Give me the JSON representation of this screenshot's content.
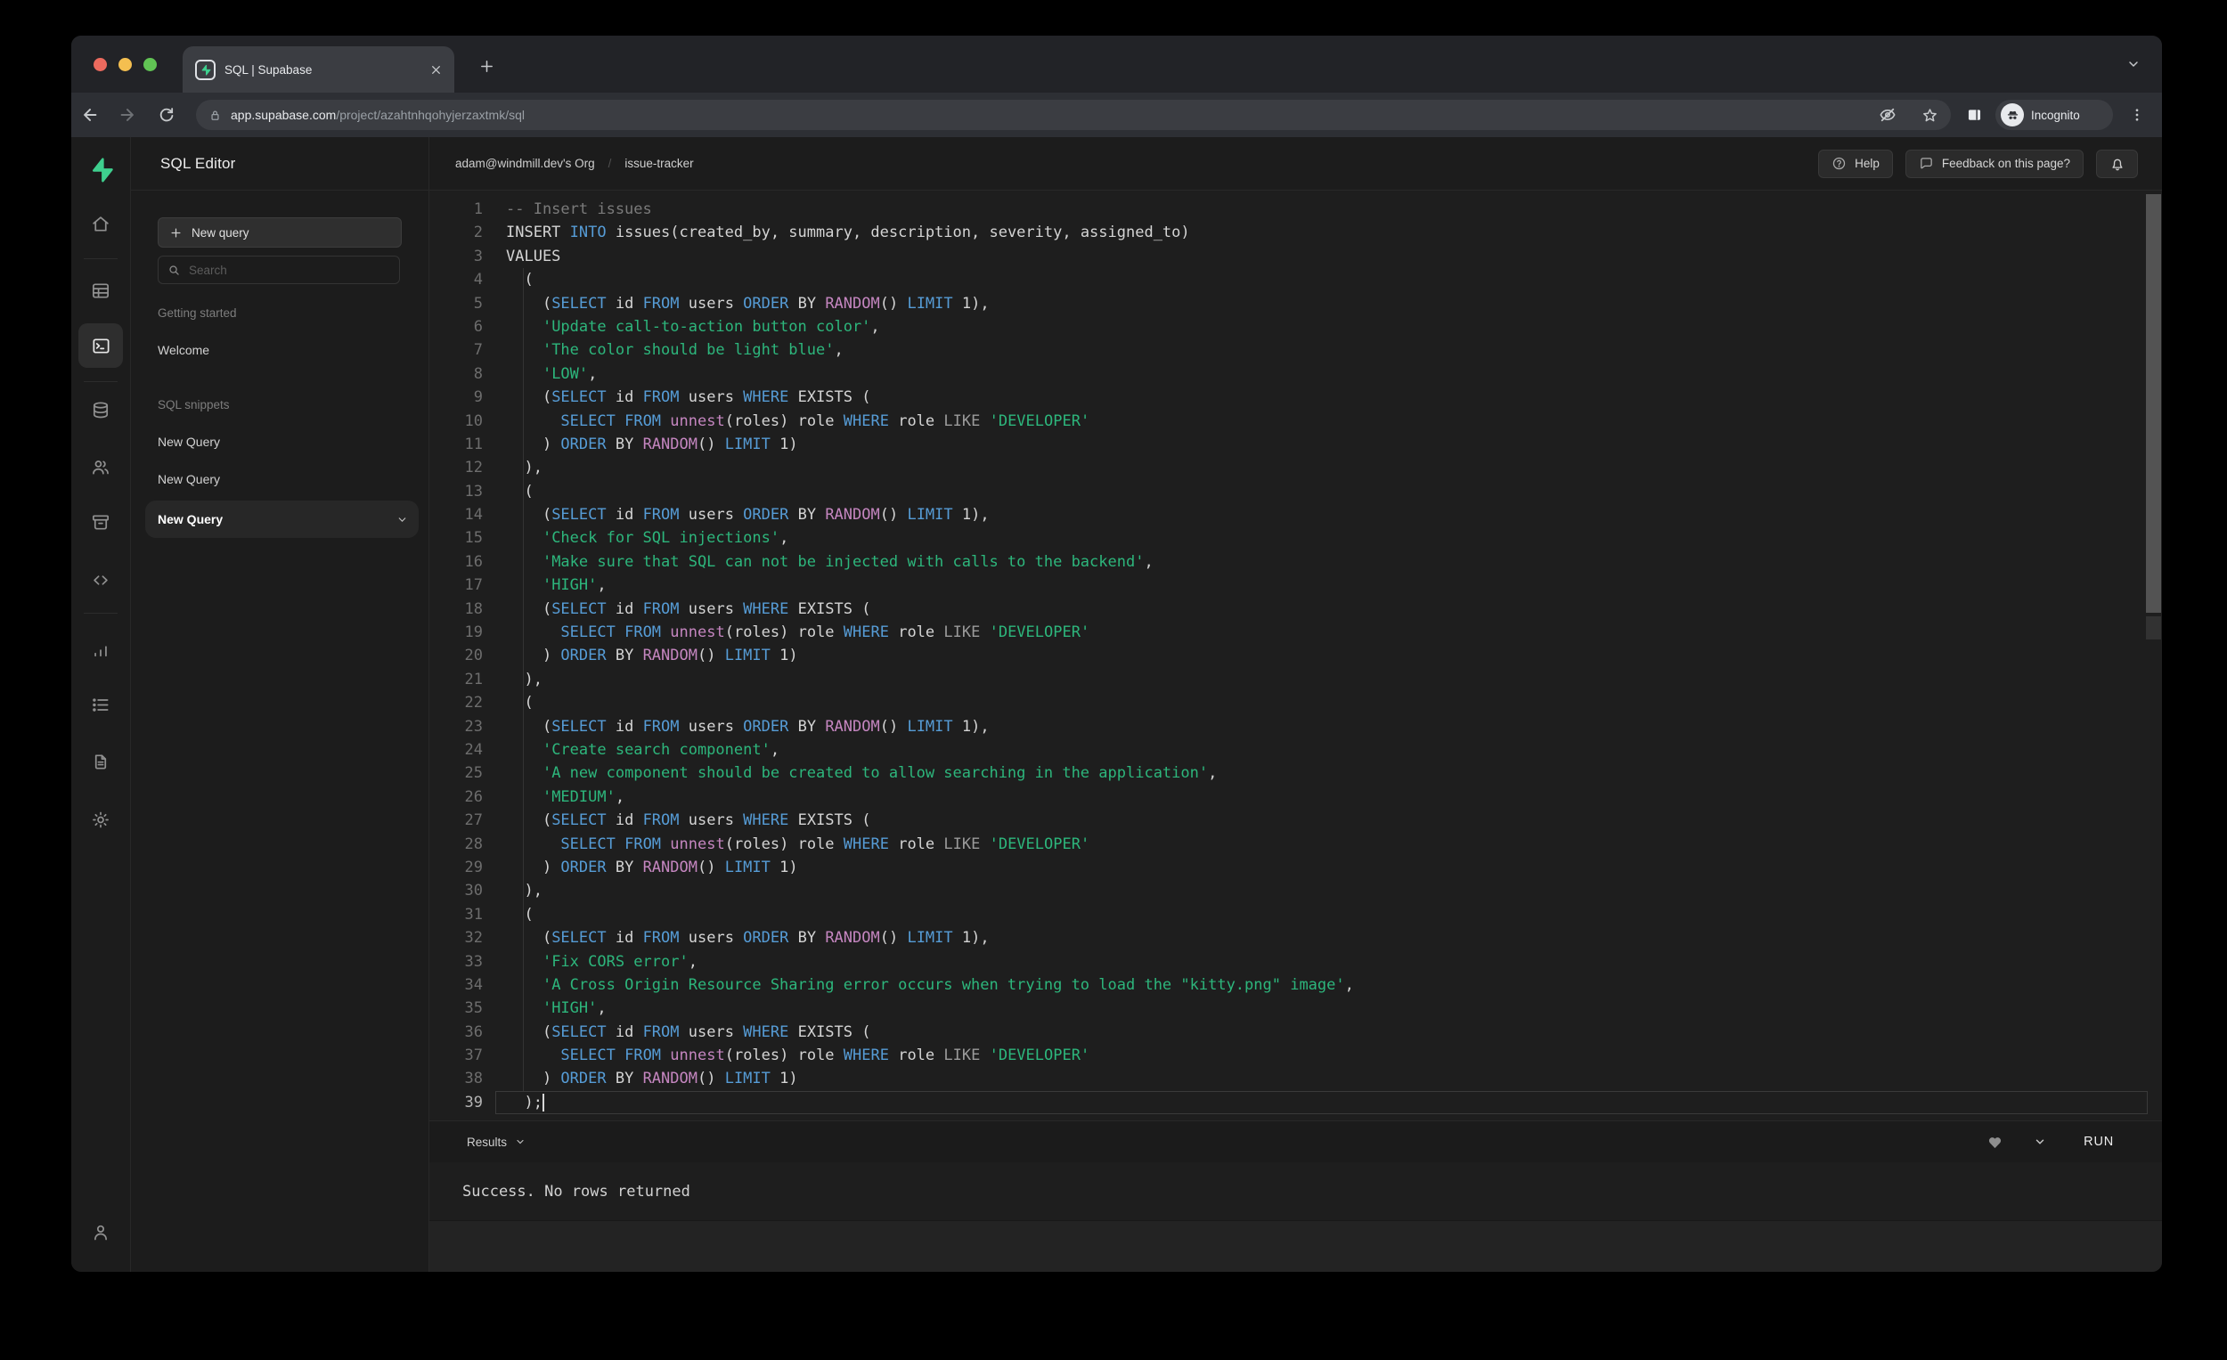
{
  "browser": {
    "tab_title": "SQL | Supabase",
    "url_host": "app.supabase.com",
    "url_path": "/project/azahtnhqohyjerzaxtmk/sql",
    "incognito_label": "Incognito"
  },
  "colors": {
    "brand_green": "#3ecf8e",
    "token_p": "#d4d4d4",
    "token_k": "#569cd6",
    "token_f": "#c586c0",
    "token_s": "#2db67c",
    "token_o": "#9b9b9b",
    "token_c": "#7a7a7a"
  },
  "rail": {
    "items": [
      {
        "name": "supabase-logo-icon"
      },
      {
        "name": "home-icon"
      },
      {
        "name": "divider"
      },
      {
        "name": "table-editor-icon"
      },
      {
        "name": "sql-editor-icon",
        "active": true
      },
      {
        "name": "divider"
      },
      {
        "name": "database-icon"
      },
      {
        "name": "auth-users-icon"
      },
      {
        "name": "storage-icon"
      },
      {
        "name": "code-icon"
      },
      {
        "name": "divider"
      },
      {
        "name": "reports-icon"
      },
      {
        "name": "logs-icon"
      },
      {
        "name": "docs-icon"
      },
      {
        "name": "settings-icon"
      },
      {
        "name": "account-icon"
      }
    ]
  },
  "sidebar": {
    "title": "SQL Editor",
    "new_query_button": "New query",
    "search_placeholder": "Search",
    "sections": [
      {
        "heading": "Getting started",
        "items": [
          {
            "label": "Welcome",
            "active": false
          }
        ]
      },
      {
        "heading": "SQL snippets",
        "items": [
          {
            "label": "New Query",
            "active": false
          },
          {
            "label": "New Query",
            "active": false
          },
          {
            "label": "New Query",
            "active": true
          }
        ]
      }
    ]
  },
  "header": {
    "org": "adam@windmill.dev's Org",
    "separator": "/",
    "project": "issue-tracker",
    "help_label": "Help",
    "feedback_label": "Feedback on this page?"
  },
  "results": {
    "label": "Results",
    "run_label": "RUN",
    "message": "Success. No rows returned"
  },
  "editor": {
    "lines": [
      {
        "n": 1,
        "t": [
          [
            "c",
            "-- Insert issues"
          ]
        ]
      },
      {
        "n": 2,
        "t": [
          [
            "p",
            "INSERT "
          ],
          [
            "k",
            "INTO"
          ],
          [
            "p",
            " issues(created_by, summary, description, severity, assigned_to)"
          ]
        ]
      },
      {
        "n": 3,
        "t": [
          [
            "p",
            "VALUES"
          ]
        ]
      },
      {
        "n": 4,
        "t": [
          [
            "p",
            "  ("
          ]
        ]
      },
      {
        "n": 5,
        "t": [
          [
            "p",
            "    ("
          ],
          [
            "k",
            "SELECT"
          ],
          [
            "p",
            " id "
          ],
          [
            "k",
            "FROM"
          ],
          [
            "p",
            " users "
          ],
          [
            "k",
            "ORDER"
          ],
          [
            "p",
            " BY "
          ],
          [
            "f",
            "RANDOM"
          ],
          [
            "p",
            "() "
          ],
          [
            "k",
            "LIMIT"
          ],
          [
            "p",
            " 1),"
          ]
        ]
      },
      {
        "n": 6,
        "t": [
          [
            "p",
            "    "
          ],
          [
            "s",
            "'Update call-to-action button color'"
          ],
          [
            "p",
            ","
          ]
        ]
      },
      {
        "n": 7,
        "t": [
          [
            "p",
            "    "
          ],
          [
            "s",
            "'The color should be light blue'"
          ],
          [
            "p",
            ","
          ]
        ]
      },
      {
        "n": 8,
        "t": [
          [
            "p",
            "    "
          ],
          [
            "s",
            "'LOW'"
          ],
          [
            "p",
            ","
          ]
        ]
      },
      {
        "n": 9,
        "t": [
          [
            "p",
            "    ("
          ],
          [
            "k",
            "SELECT"
          ],
          [
            "p",
            " id "
          ],
          [
            "k",
            "FROM"
          ],
          [
            "p",
            " users "
          ],
          [
            "k",
            "WHERE"
          ],
          [
            "p",
            " EXISTS ("
          ]
        ]
      },
      {
        "n": 10,
        "t": [
          [
            "p",
            "      "
          ],
          [
            "k",
            "SELECT"
          ],
          [
            "p",
            " "
          ],
          [
            "k",
            "FROM"
          ],
          [
            "p",
            " "
          ],
          [
            "f",
            "unnest"
          ],
          [
            "p",
            "(roles) role "
          ],
          [
            "k",
            "WHERE"
          ],
          [
            "p",
            " role "
          ],
          [
            "o",
            "LIKE"
          ],
          [
            "p",
            " "
          ],
          [
            "s",
            "'DEVELOPER'"
          ]
        ]
      },
      {
        "n": 11,
        "t": [
          [
            "p",
            "    ) "
          ],
          [
            "k",
            "ORDER"
          ],
          [
            "p",
            " BY "
          ],
          [
            "f",
            "RANDOM"
          ],
          [
            "p",
            "() "
          ],
          [
            "k",
            "LIMIT"
          ],
          [
            "p",
            " 1)"
          ]
        ]
      },
      {
        "n": 12,
        "t": [
          [
            "p",
            "  ),"
          ]
        ]
      },
      {
        "n": 13,
        "t": [
          [
            "p",
            "  ("
          ]
        ]
      },
      {
        "n": 14,
        "t": [
          [
            "p",
            "    ("
          ],
          [
            "k",
            "SELECT"
          ],
          [
            "p",
            " id "
          ],
          [
            "k",
            "FROM"
          ],
          [
            "p",
            " users "
          ],
          [
            "k",
            "ORDER"
          ],
          [
            "p",
            " BY "
          ],
          [
            "f",
            "RANDOM"
          ],
          [
            "p",
            "() "
          ],
          [
            "k",
            "LIMIT"
          ],
          [
            "p",
            " 1),"
          ]
        ]
      },
      {
        "n": 15,
        "t": [
          [
            "p",
            "    "
          ],
          [
            "s",
            "'Check for SQL injections'"
          ],
          [
            "p",
            ","
          ]
        ]
      },
      {
        "n": 16,
        "t": [
          [
            "p",
            "    "
          ],
          [
            "s",
            "'Make sure that SQL can not be injected with calls to the backend'"
          ],
          [
            "p",
            ","
          ]
        ]
      },
      {
        "n": 17,
        "t": [
          [
            "p",
            "    "
          ],
          [
            "s",
            "'HIGH'"
          ],
          [
            "p",
            ","
          ]
        ]
      },
      {
        "n": 18,
        "t": [
          [
            "p",
            "    ("
          ],
          [
            "k",
            "SELECT"
          ],
          [
            "p",
            " id "
          ],
          [
            "k",
            "FROM"
          ],
          [
            "p",
            " users "
          ],
          [
            "k",
            "WHERE"
          ],
          [
            "p",
            " EXISTS ("
          ]
        ]
      },
      {
        "n": 19,
        "t": [
          [
            "p",
            "      "
          ],
          [
            "k",
            "SELECT"
          ],
          [
            "p",
            " "
          ],
          [
            "k",
            "FROM"
          ],
          [
            "p",
            " "
          ],
          [
            "f",
            "unnest"
          ],
          [
            "p",
            "(roles) role "
          ],
          [
            "k",
            "WHERE"
          ],
          [
            "p",
            " role "
          ],
          [
            "o",
            "LIKE"
          ],
          [
            "p",
            " "
          ],
          [
            "s",
            "'DEVELOPER'"
          ]
        ]
      },
      {
        "n": 20,
        "t": [
          [
            "p",
            "    ) "
          ],
          [
            "k",
            "ORDER"
          ],
          [
            "p",
            " BY "
          ],
          [
            "f",
            "RANDOM"
          ],
          [
            "p",
            "() "
          ],
          [
            "k",
            "LIMIT"
          ],
          [
            "p",
            " 1)"
          ]
        ]
      },
      {
        "n": 21,
        "t": [
          [
            "p",
            "  ),"
          ]
        ]
      },
      {
        "n": 22,
        "t": [
          [
            "p",
            "  ("
          ]
        ]
      },
      {
        "n": 23,
        "t": [
          [
            "p",
            "    ("
          ],
          [
            "k",
            "SELECT"
          ],
          [
            "p",
            " id "
          ],
          [
            "k",
            "FROM"
          ],
          [
            "p",
            " users "
          ],
          [
            "k",
            "ORDER"
          ],
          [
            "p",
            " BY "
          ],
          [
            "f",
            "RANDOM"
          ],
          [
            "p",
            "() "
          ],
          [
            "k",
            "LIMIT"
          ],
          [
            "p",
            " 1),"
          ]
        ]
      },
      {
        "n": 24,
        "t": [
          [
            "p",
            "    "
          ],
          [
            "s",
            "'Create search component'"
          ],
          [
            "p",
            ","
          ]
        ]
      },
      {
        "n": 25,
        "t": [
          [
            "p",
            "    "
          ],
          [
            "s",
            "'A new component should be created to allow searching in the application'"
          ],
          [
            "p",
            ","
          ]
        ]
      },
      {
        "n": 26,
        "t": [
          [
            "p",
            "    "
          ],
          [
            "s",
            "'MEDIUM'"
          ],
          [
            "p",
            ","
          ]
        ]
      },
      {
        "n": 27,
        "t": [
          [
            "p",
            "    ("
          ],
          [
            "k",
            "SELECT"
          ],
          [
            "p",
            " id "
          ],
          [
            "k",
            "FROM"
          ],
          [
            "p",
            " users "
          ],
          [
            "k",
            "WHERE"
          ],
          [
            "p",
            " EXISTS ("
          ]
        ]
      },
      {
        "n": 28,
        "t": [
          [
            "p",
            "      "
          ],
          [
            "k",
            "SELECT"
          ],
          [
            "p",
            " "
          ],
          [
            "k",
            "FROM"
          ],
          [
            "p",
            " "
          ],
          [
            "f",
            "unnest"
          ],
          [
            "p",
            "(roles) role "
          ],
          [
            "k",
            "WHERE"
          ],
          [
            "p",
            " role "
          ],
          [
            "o",
            "LIKE"
          ],
          [
            "p",
            " "
          ],
          [
            "s",
            "'DEVELOPER'"
          ]
        ]
      },
      {
        "n": 29,
        "t": [
          [
            "p",
            "    ) "
          ],
          [
            "k",
            "ORDER"
          ],
          [
            "p",
            " BY "
          ],
          [
            "f",
            "RANDOM"
          ],
          [
            "p",
            "() "
          ],
          [
            "k",
            "LIMIT"
          ],
          [
            "p",
            " 1)"
          ]
        ]
      },
      {
        "n": 30,
        "t": [
          [
            "p",
            "  ),"
          ]
        ]
      },
      {
        "n": 31,
        "t": [
          [
            "p",
            "  ("
          ]
        ]
      },
      {
        "n": 32,
        "t": [
          [
            "p",
            "    ("
          ],
          [
            "k",
            "SELECT"
          ],
          [
            "p",
            " id "
          ],
          [
            "k",
            "FROM"
          ],
          [
            "p",
            " users "
          ],
          [
            "k",
            "ORDER"
          ],
          [
            "p",
            " BY "
          ],
          [
            "f",
            "RANDOM"
          ],
          [
            "p",
            "() "
          ],
          [
            "k",
            "LIMIT"
          ],
          [
            "p",
            " 1),"
          ]
        ]
      },
      {
        "n": 33,
        "t": [
          [
            "p",
            "    "
          ],
          [
            "s",
            "'Fix CORS error'"
          ],
          [
            "p",
            ","
          ]
        ]
      },
      {
        "n": 34,
        "t": [
          [
            "p",
            "    "
          ],
          [
            "s",
            "'A Cross Origin Resource Sharing error occurs when trying to load the \"kitty.png\" image'"
          ],
          [
            "p",
            ","
          ]
        ]
      },
      {
        "n": 35,
        "t": [
          [
            "p",
            "    "
          ],
          [
            "s",
            "'HIGH'"
          ],
          [
            "p",
            ","
          ]
        ]
      },
      {
        "n": 36,
        "t": [
          [
            "p",
            "    ("
          ],
          [
            "k",
            "SELECT"
          ],
          [
            "p",
            " id "
          ],
          [
            "k",
            "FROM"
          ],
          [
            "p",
            " users "
          ],
          [
            "k",
            "WHERE"
          ],
          [
            "p",
            " EXISTS ("
          ]
        ]
      },
      {
        "n": 37,
        "t": [
          [
            "p",
            "      "
          ],
          [
            "k",
            "SELECT"
          ],
          [
            "p",
            " "
          ],
          [
            "k",
            "FROM"
          ],
          [
            "p",
            " "
          ],
          [
            "f",
            "unnest"
          ],
          [
            "p",
            "(roles) role "
          ],
          [
            "k",
            "WHERE"
          ],
          [
            "p",
            " role "
          ],
          [
            "o",
            "LIKE"
          ],
          [
            "p",
            " "
          ],
          [
            "s",
            "'DEVELOPER'"
          ]
        ]
      },
      {
        "n": 38,
        "t": [
          [
            "p",
            "    ) "
          ],
          [
            "k",
            "ORDER"
          ],
          [
            "p",
            " BY "
          ],
          [
            "f",
            "RANDOM"
          ],
          [
            "p",
            "() "
          ],
          [
            "k",
            "LIMIT"
          ],
          [
            "p",
            " 1)"
          ]
        ]
      },
      {
        "n": 39,
        "t": [
          [
            "p",
            "  );"
          ],
          [
            "cursor",
            ""
          ]
        ],
        "current": true
      }
    ]
  }
}
